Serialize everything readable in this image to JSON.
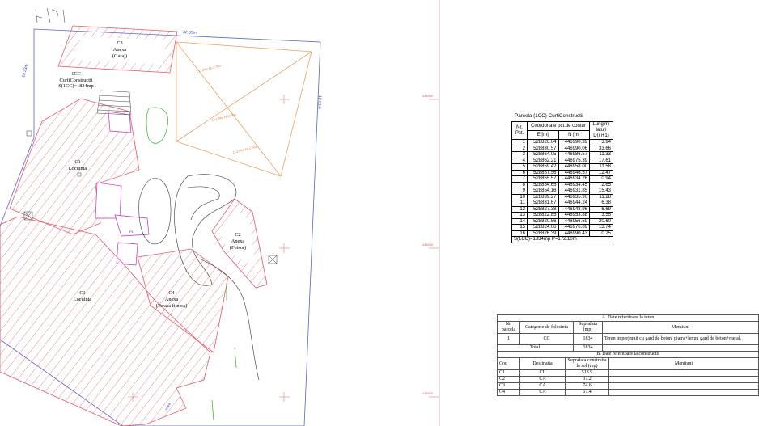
{
  "plan_labels": {
    "c3": {
      "code": "C3",
      "name": "Anexa",
      "use": "(Garaj)"
    },
    "parcel": {
      "code": "1CC",
      "name": "CurtiConstructii",
      "area": "S(1CC)=1834mp"
    },
    "c1_upper": {
      "code": "C1",
      "name": "Locuinta"
    },
    "c1_lower": {
      "code": "C1",
      "name": "Locuinta"
    },
    "c2": {
      "code": "C2",
      "name": "Anexa",
      "use": "(Foisor)"
    },
    "c4": {
      "code": "C4",
      "name": "Anexa",
      "use": "(Terasa fitness)"
    },
    "dim_top": "32.65m",
    "dim_left": "19.23m",
    "dim_right": "12.01m"
  },
  "coord_table": {
    "caption": "Parcela (1CC)  CurtiConstructii",
    "headers": {
      "nr": "Nr. Pct.",
      "coords": "Coordonate pct.de contur",
      "e": "E [m]",
      "n": "N [m]",
      "len": "Lungimi laturi D(i,i+1)"
    },
    "rows": [
      [
        "1",
        "528826.64",
        "446990.39",
        "3.94"
      ],
      [
        "2",
        "528830.57",
        "446990.06",
        "33.66"
      ],
      [
        "3",
        "528864.05",
        "446986.57",
        "11.33"
      ],
      [
        "4",
        "528862.21",
        "446975.39",
        "17.61"
      ],
      [
        "5",
        "528859.42",
        "446958.00",
        "11.58"
      ],
      [
        "6",
        "528857.56",
        "446946.57",
        "12.47"
      ],
      [
        "7",
        "528855.57",
        "446934.26",
        "0.94"
      ],
      [
        "8",
        "528854.65",
        "446934.45",
        "2.65"
      ],
      [
        "9",
        "528854.16",
        "446931.85",
        "15.43"
      ],
      [
        "10",
        "528839.27",
        "446935.90",
        "11.28"
      ],
      [
        "11",
        "528831.67",
        "446944.24",
        "6.38"
      ],
      [
        "12",
        "528827.38",
        "446948.96",
        "6.69"
      ],
      [
        "13",
        "528822.85",
        "446953.88",
        "3.55"
      ],
      [
        "14",
        "528820.56",
        "446956.59",
        "20.60"
      ],
      [
        "15",
        "528824.06",
        "446976.89",
        "13.74"
      ],
      [
        "16",
        "528826.39",
        "446990.43",
        "0.25"
      ]
    ],
    "footer": "S(1CC)=1834mp  P=172.10m"
  },
  "info_table": {
    "section_a": "A. Date referitoare la teren",
    "a_headers": {
      "nr": "Nr. parcela",
      "cat": "Categorie de folosinta",
      "sup": "Suprafata (mp)",
      "ment": "Mentiuni"
    },
    "a_rows": [
      {
        "nr": "1",
        "cat": "CC",
        "sup": "1834",
        "ment": "Teren imprejmuit cu gard de beton, piatra+lemn, gard de beton+metal."
      }
    ],
    "a_total_label": "Total",
    "a_total_value": "1834",
    "section_b": "B. Date referitoare la constructii",
    "b_headers": {
      "cod": "Cod",
      "dest": "Destinatia",
      "sup": "Suprafata construita la sol (mp)",
      "ment": "Mentiuni"
    },
    "b_rows": [
      {
        "cod": "C1",
        "dest": "CL",
        "sup": "513.9"
      },
      {
        "cod": "C2",
        "dest": "CA",
        "sup": "37.2"
      },
      {
        "cod": "C3",
        "dest": "CA",
        "sup": "74.6"
      },
      {
        "cod": "C4",
        "dest": "CA",
        "sup": "67.4"
      }
    ]
  }
}
